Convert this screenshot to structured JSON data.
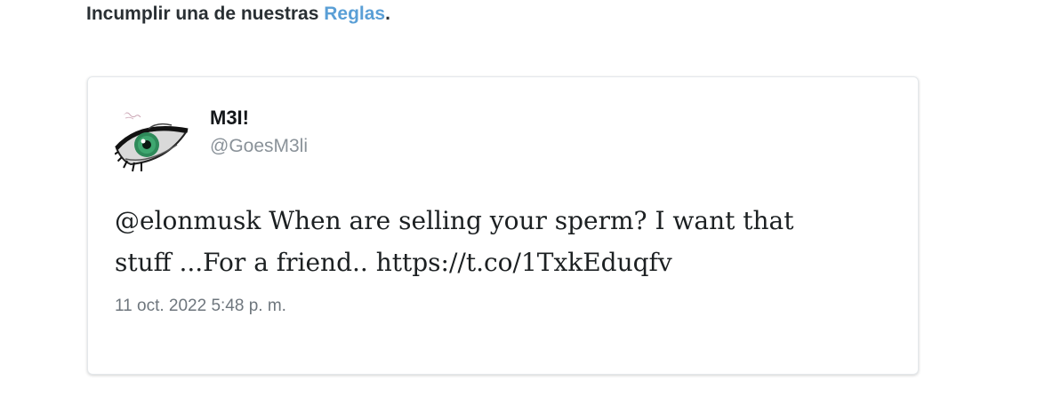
{
  "notice": {
    "prefix": "Incumplir una de nuestras ",
    "link_label": "Reglas",
    "suffix": "."
  },
  "tweet": {
    "display_name": "M3I!",
    "handle": "@GoesM3li",
    "text_line1": "@elonmusk When are selling your sperm? I want that",
    "text_line2": "stuff ...For a friend.. https://t.co/1TxkEduqfv",
    "timestamp": "11 oct. 2022 5:48 p. m."
  },
  "colors": {
    "link": "#5a9fd6",
    "eye_iris": "#2e8a5a"
  },
  "icons": {
    "avatar": "eye-drawing-avatar"
  }
}
